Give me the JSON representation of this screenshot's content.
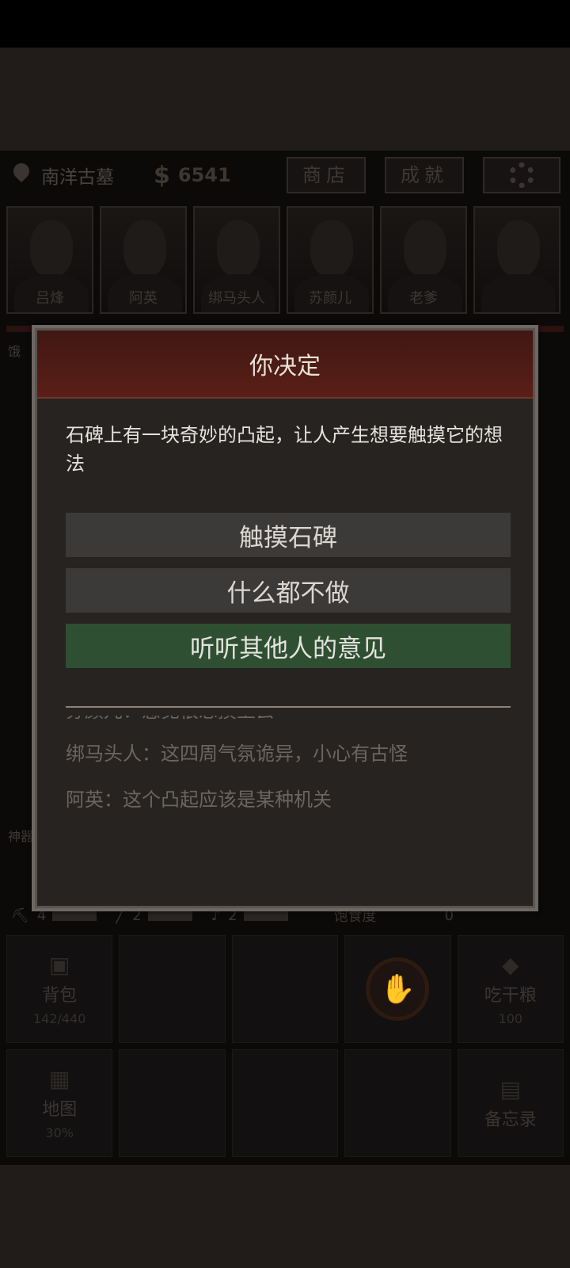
{
  "hud": {
    "location": "南洋古墓",
    "money_sign": "$",
    "money": "6541",
    "shop_label": "商店",
    "achievements_label": "成就"
  },
  "portraits": [
    {
      "name": "吕烽"
    },
    {
      "name": "阿英"
    },
    {
      "name": "绑马头人"
    },
    {
      "name": "苏颜儿"
    },
    {
      "name": "老爹"
    },
    {
      "name": ""
    }
  ],
  "side": {
    "hunger_tag": "饿",
    "item_tag": "神器"
  },
  "stats": {
    "pick_count": "4",
    "rope_count": "2",
    "shovel_count": "2",
    "satiety_label": "饱食度",
    "satiety_value": "0"
  },
  "grid": {
    "backpack_label": "背包",
    "backpack_capacity": "142/440",
    "eat_label": "吃干粮",
    "eat_count": "100",
    "map_label": "地图",
    "map_percent": "30%",
    "memo_label": "备忘录"
  },
  "dialog": {
    "title": "你决定",
    "prompt": "石碑上有一块奇妙的凸起，让人产生想要触摸它的想法",
    "choices": [
      {
        "label": "触摸石碑"
      },
      {
        "label": "什么都不做"
      },
      {
        "label": "听听其他人的意见"
      }
    ],
    "log": [
      {
        "speaker": "苏颜儿：",
        "text": "感觉很想摸上去"
      },
      {
        "speaker": "绑马头人：",
        "text": "这四周气氛诡异，小心有古怪"
      },
      {
        "speaker": "阿英：",
        "text": "这个凸起应该是某种机关"
      }
    ]
  },
  "colors": {
    "header_red": "#5a1f17",
    "choice_gray": "#3c3a38",
    "choice_green": "#2f4f33"
  }
}
